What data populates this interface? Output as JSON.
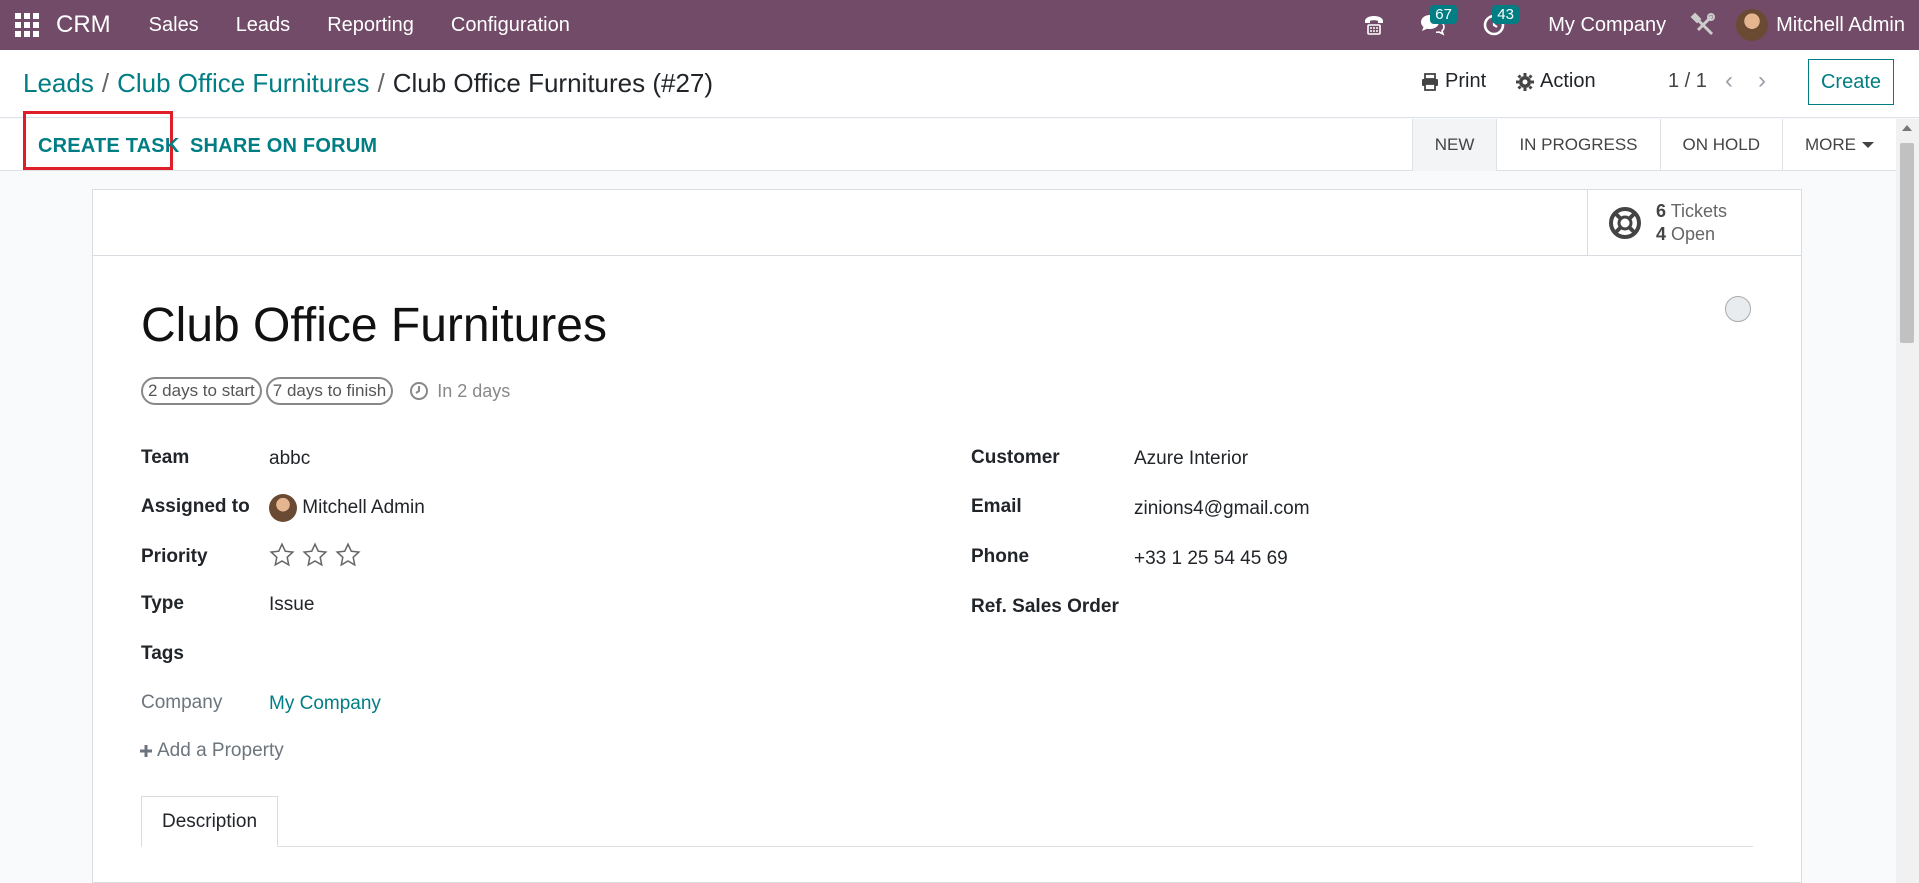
{
  "topbar": {
    "app_name": "CRM",
    "menus": [
      "Sales",
      "Leads",
      "Reporting",
      "Configuration"
    ],
    "messages_count": "67",
    "activities_count": "43",
    "company": "My Company",
    "user": "Mitchell Admin",
    "bg_color": "#714b67"
  },
  "control": {
    "breadcrumb": [
      "Leads",
      "Club Office Furnitures",
      "Club Office Furnitures (#27)"
    ],
    "print_label": "Print",
    "action_label": "Action",
    "pager": "1 / 1",
    "create_label": "Create"
  },
  "statusbar": {
    "create_task": "CREATE TASK",
    "share_forum": "SHARE ON FORUM",
    "stages": [
      "NEW",
      "IN PROGRESS",
      "ON HOLD"
    ],
    "more_label": "MORE"
  },
  "stat": {
    "tickets_count": "6",
    "tickets_label": "Tickets",
    "open_count": "4",
    "open_label": "Open"
  },
  "record": {
    "title": "Club Office Furnitures",
    "pill_start": "2 days to start",
    "pill_finish": "7 days to finish",
    "deadline": "In 2 days",
    "team_label": "Team",
    "team_value": "abbc",
    "assigned_label": "Assigned to",
    "assigned_value": "Mitchell Admin",
    "priority_label": "Priority",
    "priority_stars": 0,
    "type_label": "Type",
    "type_value": "Issue",
    "tags_label": "Tags",
    "company_label": "Company",
    "company_value": "My Company",
    "add_property": "Add a Property",
    "customer_label": "Customer",
    "customer_value": "Azure Interior",
    "email_label": "Email",
    "email_value": "zinions4@gmail.com",
    "phone_label": "Phone",
    "phone_value": "+33 1 25 54 45 69",
    "sales_order_label": "Ref. Sales Order"
  },
  "tabs": {
    "description": "Description"
  },
  "colors": {
    "accent": "#017e84",
    "highlight": "#e01e29"
  }
}
